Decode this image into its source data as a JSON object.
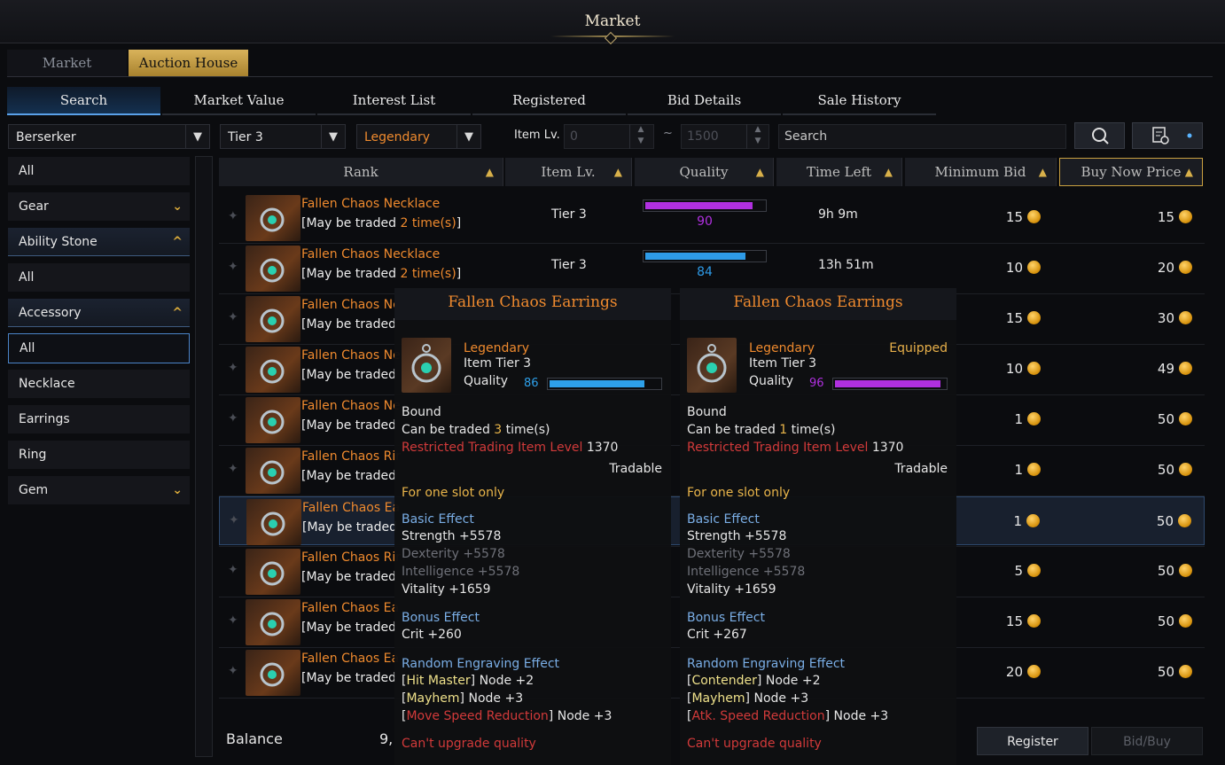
{
  "window": {
    "title": "Market"
  },
  "main_tabs": [
    {
      "label": "Market"
    },
    {
      "label": "Auction House"
    }
  ],
  "sub_tabs": [
    {
      "label": "Search"
    },
    {
      "label": "Market Value"
    },
    {
      "label": "Interest List"
    },
    {
      "label": "Registered"
    },
    {
      "label": "Bid Details"
    },
    {
      "label": "Sale History"
    }
  ],
  "filters": {
    "class": "Berserker",
    "tier": "Tier 3",
    "grade": "Legendary",
    "item_lv_label": "Item Lv.",
    "item_lv_min": "0",
    "item_lv_sep": "~",
    "item_lv_max": "1500",
    "search_placeholder": "Search"
  },
  "sidebar": [
    {
      "label": "All"
    },
    {
      "label": "Gear"
    },
    {
      "label": "Ability Stone"
    },
    {
      "label": "All"
    },
    {
      "label": "Accessory"
    },
    {
      "label": "All"
    },
    {
      "label": "Necklace"
    },
    {
      "label": "Earrings"
    },
    {
      "label": "Ring"
    },
    {
      "label": "Gem"
    }
  ],
  "columns": {
    "rank": "Rank",
    "item_lv": "Item Lv.",
    "quality": "Quality",
    "time_left": "Time Left",
    "min_bid": "Minimum Bid",
    "buy_now": "Buy Now Price"
  },
  "rows": [
    {
      "name": "Fallen Chaos Necklace",
      "trade_pre": "[May be traded ",
      "trade_count": "2 time(s)",
      "trade_post": "]",
      "tier": "Tier 3",
      "quality": "90",
      "quality_frac": 0.9,
      "quality_color": "#b030e0",
      "time_left": "9h 9m",
      "min_bid": "15",
      "buy_now": "15"
    },
    {
      "name": "Fallen Chaos Necklace",
      "trade_pre": "[May be traded ",
      "trade_count": "2 time(s)",
      "trade_post": "]",
      "tier": "Tier 3",
      "quality": "84",
      "quality_frac": 0.84,
      "quality_color": "#2e9be8",
      "time_left": "13h 51m",
      "min_bid": "10",
      "buy_now": "20"
    },
    {
      "name": "Fallen Chaos Ne",
      "trade_pre": "[May be traded ",
      "min_bid": "15",
      "buy_now": "30"
    },
    {
      "name": "Fallen Chaos Ne",
      "trade_pre": "[May be traded ",
      "min_bid": "10",
      "buy_now": "49"
    },
    {
      "name": "Fallen Chaos Ne",
      "trade_pre": "[May be traded ",
      "min_bid": "1",
      "buy_now": "50"
    },
    {
      "name": "Fallen Chaos Rir",
      "trade_pre": "[May be traded ",
      "min_bid": "1",
      "buy_now": "50"
    },
    {
      "name": "Fallen Chaos Ea",
      "trade_pre": "[May be traded ",
      "min_bid": "1",
      "buy_now": "50"
    },
    {
      "name": "Fallen Chaos Rir",
      "trade_pre": "[May be traded ",
      "min_bid": "5",
      "buy_now": "50"
    },
    {
      "name": "Fallen Chaos Ea",
      "trade_pre": "[May be traded ",
      "min_bid": "15",
      "buy_now": "50"
    },
    {
      "name": "Fallen Chaos Ea",
      "trade_pre": "[May be traded ",
      "min_bid": "20",
      "buy_now": "50"
    }
  ],
  "bottom": {
    "balance_label": "Balance",
    "balance_value": "9,",
    "register": "Register",
    "bid_buy": "Bid/Buy"
  },
  "tooltips": [
    {
      "title": "Fallen Chaos Earrings",
      "grade": "Legendary",
      "equipped": "",
      "item_tier": "Item Tier 3",
      "quality_label": "Quality",
      "quality": "86",
      "quality_frac": 0.86,
      "quality_color": "#2ea0ea",
      "bound": "Bound",
      "trade_pre": "Can be traded ",
      "trade_n": "3",
      "trade_post": " time(s)",
      "restricted_label": "Restricted Trading Item Level",
      "restricted_value": "1370",
      "tradable": "Tradable",
      "slot": "For one slot only",
      "basic_label": "Basic Effect",
      "basic": [
        "Strength +5578",
        "Dexterity +5578",
        "Intelligence +5578",
        "Vitality +1659"
      ],
      "bonus_label": "Bonus Effect",
      "bonus": "Crit +260",
      "engr_label": "Random Engraving Effect",
      "engr": [
        {
          "name": "Hit Master",
          "node": "Node +2",
          "color": "#eee08a"
        },
        {
          "name": "Mayhem",
          "node": "Node +3",
          "color": "#eee08a"
        },
        {
          "name": "Move Speed Reduction",
          "node": "Node +3",
          "color": "#d23a3a"
        }
      ],
      "cant": "Can't upgrade quality"
    },
    {
      "title": "Fallen Chaos Earrings",
      "grade": "Legendary",
      "equipped": "Equipped",
      "item_tier": "Item Tier 3",
      "quality_label": "Quality",
      "quality": "96",
      "quality_frac": 0.96,
      "quality_color": "#b030e0",
      "bound": "Bound",
      "trade_pre": "Can be traded ",
      "trade_n": "1",
      "trade_post": " time(s)",
      "restricted_label": "Restricted Trading Item Level",
      "restricted_value": "1370",
      "tradable": "Tradable",
      "slot": "For one slot only",
      "basic_label": "Basic Effect",
      "basic": [
        "Strength +5578",
        "Dexterity +5578",
        "Intelligence +5578",
        "Vitality +1659"
      ],
      "bonus_label": "Bonus Effect",
      "bonus": "Crit +267",
      "engr_label": "Random Engraving Effect",
      "engr": [
        {
          "name": "Contender",
          "node": "Node +2",
          "color": "#eee08a"
        },
        {
          "name": "Mayhem",
          "node": "Node +3",
          "color": "#eee08a"
        },
        {
          "name": "Atk. Speed Reduction",
          "node": "Node +3",
          "color": "#d23a3a"
        }
      ],
      "cant": "Can't upgrade quality"
    }
  ]
}
